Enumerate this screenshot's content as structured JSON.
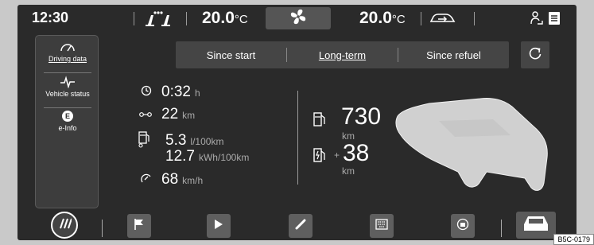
{
  "topbar": {
    "time": "12:30",
    "temp_left_value": "20.0",
    "temp_left_unit": "°C",
    "temp_right_value": "20.0",
    "temp_right_unit": "°C"
  },
  "sidebar": {
    "items": [
      {
        "label": "Driving data",
        "icon": "gauge-icon"
      },
      {
        "label": "Vehicle status",
        "icon": "pulse-icon"
      },
      {
        "label": "e-Info",
        "icon": "e-badge-icon",
        "badge": "E"
      }
    ]
  },
  "tabs": [
    {
      "label": "Since start"
    },
    {
      "label": "Long-term"
    },
    {
      "label": "Since refuel"
    }
  ],
  "stats": {
    "duration_value": "0:32",
    "duration_unit": "h",
    "distance_value": "22",
    "distance_unit": "km",
    "fuel_cons_value": "5.3",
    "fuel_cons_unit": "l/100km",
    "elec_cons_value": "12.7",
    "elec_cons_unit": "kWh/100km",
    "speed_value": "68",
    "speed_unit": "km/h"
  },
  "range": {
    "fuel_range_value": "730",
    "fuel_range_unit": "km",
    "plus_sign": "+",
    "elec_range_value": "38",
    "elec_range_unit": "km"
  },
  "dock": {
    "items": [
      "menu-icon",
      "flag-icon",
      "play-icon",
      "phone-icon",
      "keyboard-icon",
      "charging-icon",
      "car-icon"
    ]
  },
  "image_code": "B5C-0179",
  "colors": {
    "screen_bg": "#2a2a2a",
    "panel_bg": "#454545",
    "text": "#ffffff",
    "unit_text": "#aaaaaa",
    "car_fill": "#d0d0d0"
  }
}
